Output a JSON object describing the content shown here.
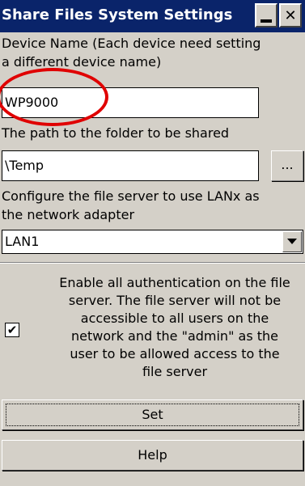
{
  "window": {
    "title": "Share Files System Settings",
    "minimize_icon": "minimize-icon",
    "close_icon": "close-icon",
    "close_glyph": "✕"
  },
  "device_name": {
    "label_line1": "Device Name (Each device need setting",
    "label_line2": "a different device name)",
    "value": "WP9000"
  },
  "shared_path": {
    "label": "The path to the folder to be shared",
    "value": "\\Temp",
    "browse_label": "..."
  },
  "network_adapter": {
    "label_line1": "Configure the file server to use LANx as",
    "label_line2": "the network adapter",
    "selected": "LAN1",
    "arrow_icon": "chevron-down-icon"
  },
  "authentication": {
    "checked": true,
    "check_glyph": "✔",
    "label_lines": [
      "Enable all authentication on the file",
      "server. The file server will not be",
      "accessible to all users on the",
      "network and the \"admin\" as the",
      "user to be allowed access to the",
      "file server"
    ]
  },
  "buttons": {
    "set_label": "Set",
    "help_label": "Help"
  },
  "colors": {
    "title_bar": "#0a246a",
    "dialog_bg": "#d4d0c8",
    "annotation": "#e00000"
  }
}
